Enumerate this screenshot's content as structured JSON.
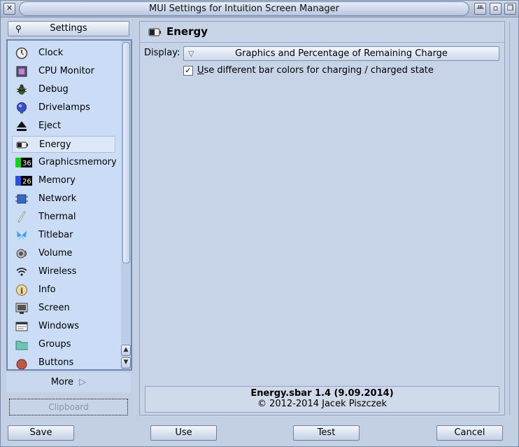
{
  "window": {
    "title": "MUI Settings for Intuition Screen Manager",
    "close_icon": "close-icon",
    "gadgets": [
      "iconify-icon",
      "zoom-icon",
      "depth-icon"
    ]
  },
  "sidebar": {
    "settings_label": "Settings",
    "items": [
      {
        "label": "Clock",
        "icon": "clock-icon"
      },
      {
        "label": "CPU Monitor",
        "icon": "chip-icon"
      },
      {
        "label": "Debug",
        "icon": "bug-icon"
      },
      {
        "label": "Drivelamps",
        "icon": "lamp-icon"
      },
      {
        "label": "Eject",
        "icon": "eject-icon"
      },
      {
        "label": "Energy",
        "icon": "battery-icon",
        "selected": true
      },
      {
        "label": "Graphicsmemory",
        "icon": "graphicsmemory-icon",
        "badge": "36"
      },
      {
        "label": "Memory",
        "icon": "memory-icon",
        "badge": "26"
      },
      {
        "label": "Network",
        "icon": "network-icon"
      },
      {
        "label": "Thermal",
        "icon": "thermometer-icon"
      },
      {
        "label": "Titlebar",
        "icon": "butterfly-icon"
      },
      {
        "label": "Volume",
        "icon": "speaker-icon"
      },
      {
        "label": "Wireless",
        "icon": "wifi-icon"
      },
      {
        "label": "Info",
        "icon": "info-icon"
      },
      {
        "label": "Screen",
        "icon": "screen-icon"
      },
      {
        "label": "Windows",
        "icon": "windows-icon"
      },
      {
        "label": "Groups",
        "icon": "folder-icon"
      },
      {
        "label": "Buttons",
        "icon": "button-icon"
      }
    ],
    "more_label": "More",
    "clipboard_label": "Clipboard"
  },
  "panel": {
    "title": "Energy",
    "display_label": "Display:",
    "display_value": "Graphics and Percentage of Remaining Charge",
    "checkbox_checked": true,
    "checkbox_label": "Use different bar colors for charging / charged state",
    "info_line1": "Energy.sbar 1.4 (9.09.2014)",
    "info_line2": "© 2012-2014 Jacek Piszczek"
  },
  "buttons": {
    "save": "Save",
    "use": "Use",
    "test": "Test",
    "cancel": "Cancel"
  },
  "colors": {
    "window_bg": "#c3cfe2",
    "list_bg": "#cbdcf6",
    "list_border": "#6d86b4",
    "selected_bg": "#dce7f8"
  }
}
